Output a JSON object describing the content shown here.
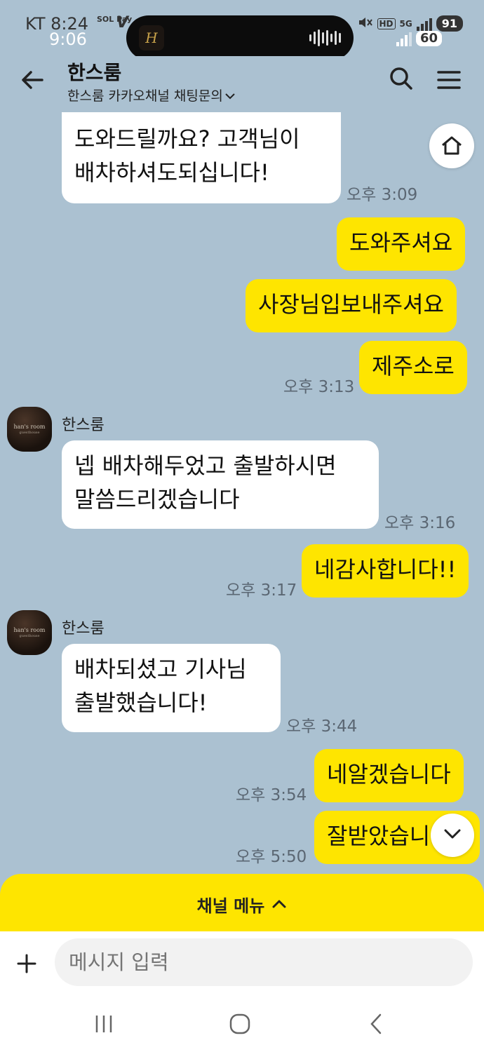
{
  "status_bar": {
    "carrier_time": "KT 8:24",
    "overlay_time": "9:06",
    "pay_label": "SOL Pay",
    "network": "5G",
    "hd": "HD",
    "battery_top": "91",
    "battery_bottom": "60"
  },
  "header": {
    "title": "한스룸",
    "subtitle": "한스룸 카카오채널 채팅문의"
  },
  "messages": [
    {
      "side": "left",
      "lines": [
        "도와드릴까요? 고객님이",
        "배차하셔도되십니다!"
      ],
      "time": "오후 3:09"
    },
    {
      "side": "right",
      "text": "도와주셔요"
    },
    {
      "side": "right",
      "text": "사장님입보내주셔요"
    },
    {
      "side": "right",
      "text": "제주소로",
      "time": "오후 3:13"
    },
    {
      "side": "left",
      "sender": "한스룸",
      "lines": [
        "넵 배차해두었고 출발하시면",
        "말씀드리겠습니다"
      ],
      "time": "오후 3:16"
    },
    {
      "side": "right",
      "text": "네감사합니다!!",
      "time": "오후 3:17"
    },
    {
      "side": "left",
      "sender": "한스룸",
      "lines": [
        "배차되셨고 기사님",
        "출발했습니다!"
      ],
      "time": "오후 3:44"
    },
    {
      "side": "right",
      "text": "네알겠습니다",
      "time": "오후 3:54"
    },
    {
      "side": "right",
      "text": "잘받았습니",
      "time": "오후 5:50"
    }
  ],
  "avatar_text": {
    "name": "han's room",
    "sub": "guesthouse"
  },
  "channel_menu": {
    "label": "채널 메뉴"
  },
  "input": {
    "placeholder": "메시지 입력"
  },
  "icons": [
    "back-arrow-icon",
    "search-icon",
    "menu-icon",
    "home-icon",
    "chevron-down-icon",
    "chevron-up-icon",
    "plus-icon",
    "recent-apps-icon",
    "home-circle-icon",
    "back-nav-icon"
  ]
}
